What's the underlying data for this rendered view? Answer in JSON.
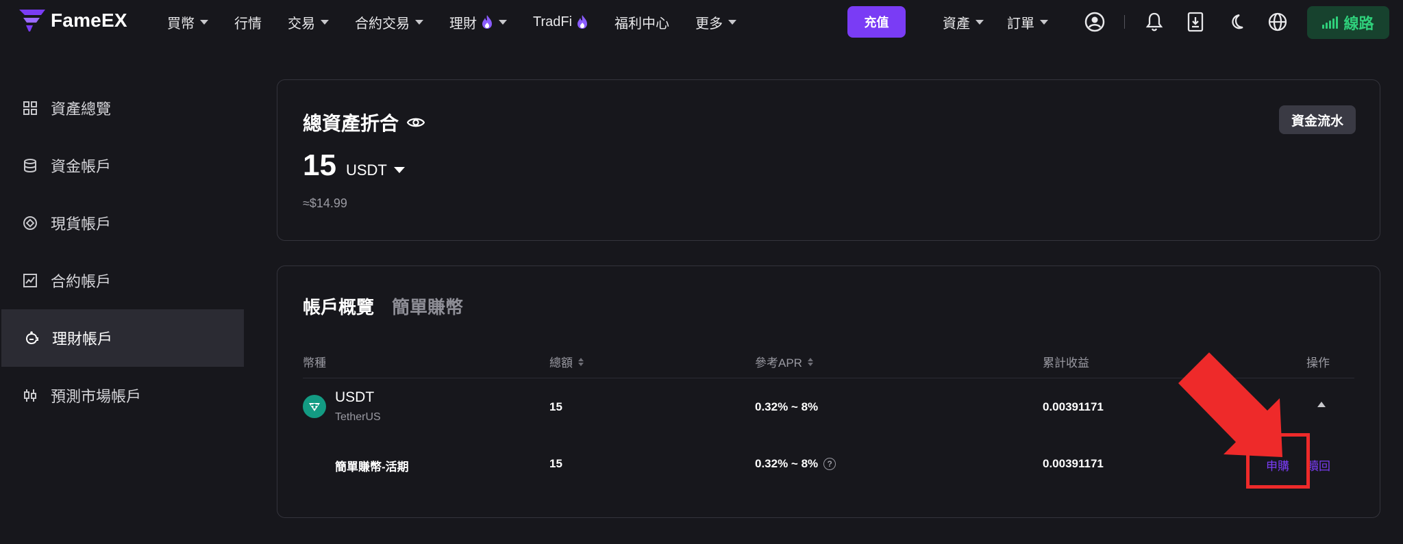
{
  "brand": {
    "name": "FameEX",
    "accent": "#7a3cf5",
    "success": "#2fd07b"
  },
  "nav": {
    "items": [
      {
        "label": "買幣",
        "dropdown": true,
        "fire": false
      },
      {
        "label": "行情",
        "dropdown": false,
        "fire": false
      },
      {
        "label": "交易",
        "dropdown": true,
        "fire": false
      },
      {
        "label": "合約交易",
        "dropdown": true,
        "fire": false
      },
      {
        "label": "理財",
        "dropdown": true,
        "fire": true
      },
      {
        "label": "TradFi",
        "dropdown": false,
        "fire": true
      },
      {
        "label": "福利中心",
        "dropdown": false,
        "fire": false
      },
      {
        "label": "更多",
        "dropdown": true,
        "fire": false
      }
    ],
    "deposit_label": "充值",
    "assets_label": "資產",
    "orders_label": "訂單",
    "line_label": "線路"
  },
  "sidebar": {
    "items": [
      {
        "label": "資產總覽",
        "icon": "grid-icon",
        "active": false
      },
      {
        "label": "資金帳戶",
        "icon": "database-icon",
        "active": false
      },
      {
        "label": "現貨帳戶",
        "icon": "target-icon",
        "active": false
      },
      {
        "label": "合約帳戶",
        "icon": "chart-icon",
        "active": false
      },
      {
        "label": "理財帳戶",
        "icon": "piggy-bank-icon",
        "active": true
      },
      {
        "label": "預測市場帳戶",
        "icon": "candlestick-icon",
        "active": false
      }
    ]
  },
  "summary": {
    "title": "總資產折合",
    "amount": "15",
    "unit": "USDT",
    "usd_value": "≈$14.99",
    "flow_button": "資金流水"
  },
  "overview": {
    "tabs": [
      "帳戶概覽",
      "簡單賺幣"
    ],
    "headers": {
      "coin": "幣種",
      "total": "總額",
      "apr": "參考APR",
      "earnings": "累計收益",
      "action": "操作"
    },
    "row": {
      "coin": "USDT",
      "coin_full": "TetherUS",
      "total": "15",
      "apr": "0.32% ~ 8%",
      "earnings": "0.00391171"
    },
    "subrow": {
      "product": "簡單賺幣-活期",
      "total": "15",
      "apr": "0.32% ~ 8%",
      "earnings": "0.00391171",
      "subscribe": "申購",
      "redeem": "贖回"
    }
  }
}
